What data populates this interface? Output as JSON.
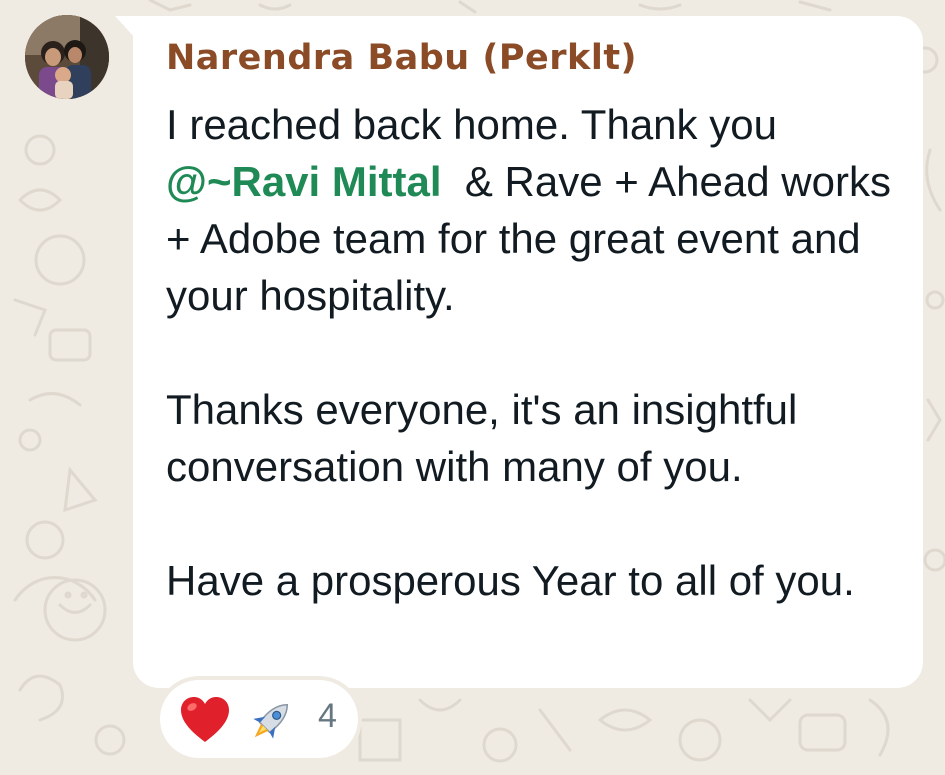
{
  "message": {
    "sender": "Narendra Babu (Perklt)",
    "paragraph1_before": "I reached back home. Thank you",
    "mention": "@~Ravi Mittal",
    "paragraph1_after": "& Rave + Ahead works + Adobe team for the great event and your hospitality.",
    "paragraph2": "Thanks everyone, it's an insightful conversation with many of you.",
    "paragraph3": "Have a prosperous Year to all of you."
  },
  "reactions": {
    "emojis": [
      "heart-icon",
      "rocket-icon"
    ],
    "count": "4"
  },
  "colors": {
    "sender": "#8a4b26",
    "mention": "#1f8a55",
    "background": "#efeae2",
    "bubble": "#ffffff"
  }
}
